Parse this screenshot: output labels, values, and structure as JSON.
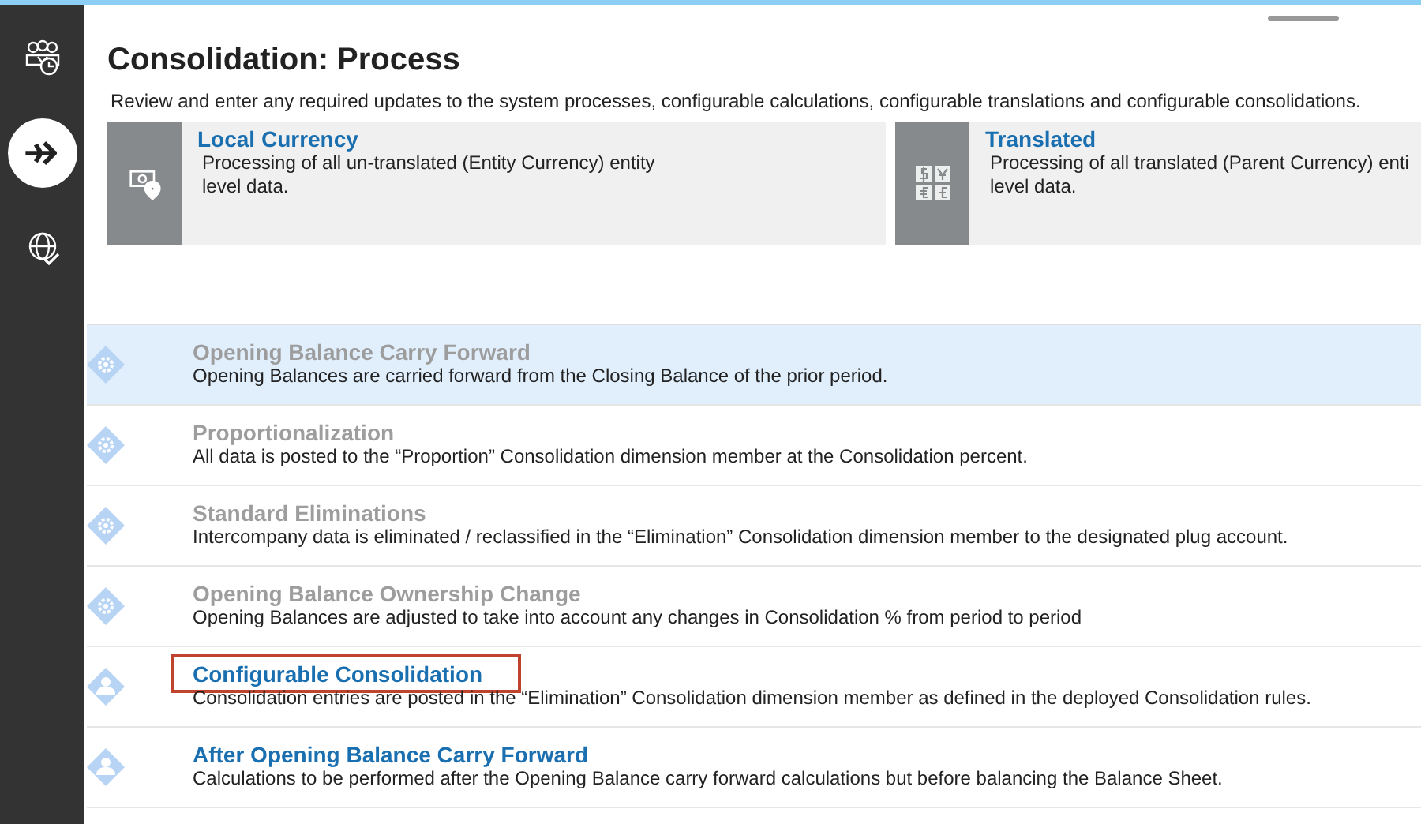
{
  "sidebar": {
    "items": [
      {
        "kind": "people",
        "selected": false
      },
      {
        "kind": "arrow",
        "selected": true
      },
      {
        "kind": "globe",
        "selected": false
      }
    ]
  },
  "page": {
    "title": "Consolidation: Process",
    "description": "Review and enter any required updates to the system processes, configurable calculations, configurable translations and configurable consolidations."
  },
  "cards": [
    {
      "kind": "money",
      "title": "Local Currency",
      "lines": [
        "Processing of all un-translated (Entity Currency) entity",
        "level data."
      ]
    },
    {
      "kind": "currencies",
      "title": "Translated",
      "lines": [
        "Processing of all translated (Parent Currency) enti",
        "level data."
      ]
    }
  ],
  "processes": [
    {
      "kind": "gear",
      "title": "Opening Balance Carry Forward",
      "description": "Opening Balances are carried forward from the Closing Balance of the prior period.",
      "selected": true,
      "disabled": true,
      "highlighted": false
    },
    {
      "kind": "gear",
      "title": "Proportionalization",
      "description": "All data is posted to the “Proportion” Consolidation dimension member at the Consolidation percent.",
      "selected": false,
      "disabled": true,
      "highlighted": false
    },
    {
      "kind": "gear",
      "title": "Standard Eliminations",
      "description": "Intercompany data is eliminated / reclassified in the “Elimination” Consolidation dimension member to the designated plug account.",
      "selected": false,
      "disabled": true,
      "highlighted": false
    },
    {
      "kind": "gear",
      "title": "Opening Balance Ownership Change",
      "description": "Opening Balances are adjusted to take into account any changes in Consolidation % from period to period",
      "selected": false,
      "disabled": true,
      "highlighted": false
    },
    {
      "kind": "person",
      "title": "Configurable Consolidation",
      "description": "Consolidation entries are posted in the “Elimination” Consolidation dimension member as defined in the deployed Consolidation rules.",
      "selected": false,
      "disabled": false,
      "highlighted": true
    },
    {
      "kind": "person",
      "title": "After Opening Balance Carry Forward",
      "description": "Calculations to be performed after the Opening Balance carry forward calculations but before balancing the Balance Sheet.",
      "selected": false,
      "disabled": false,
      "highlighted": false
    }
  ]
}
